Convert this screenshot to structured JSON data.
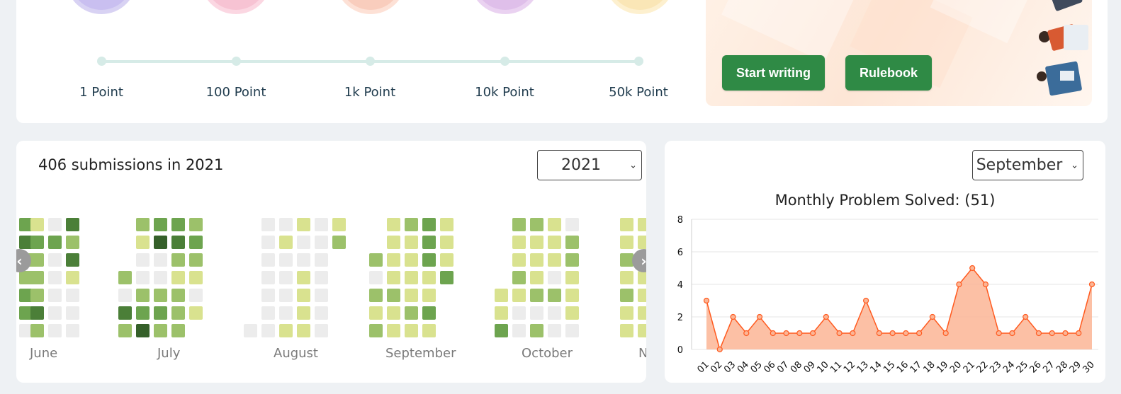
{
  "milestones": [
    {
      "label": "1 Point",
      "badge_color": "#d8d2f3",
      "inner": "#c9bff0",
      "icon": "star-badge-icon"
    },
    {
      "label": "100 Point",
      "badge_color": "#fbd7e2",
      "inner": "#f7c3d3",
      "icon": "burst-badge-icon"
    },
    {
      "label": "1k Point",
      "badge_color": "#fde1d6",
      "inner": "#f9cdbd",
      "icon": "shield-badge-icon"
    },
    {
      "label": "10k Point",
      "badge_color": "#ead2f1",
      "inner": "#dfbfea",
      "icon": "bar-badge-icon"
    },
    {
      "label": "50k Point",
      "badge_color": "#fdf0cf",
      "inner": "#faE6b6",
      "icon": "diamond-badge-icon"
    }
  ],
  "promo": {
    "start_writing": "Start writing",
    "rulebook": "Rulebook",
    "button_color": "#2f8a45"
  },
  "heatmap": {
    "title": "406 submissions in 2021",
    "year_select": "2021",
    "months": [
      "June",
      "July",
      "August",
      "September",
      "October",
      "N"
    ],
    "levels": [
      "#ececec",
      "#d9e28f",
      "#9cc16a",
      "#6da44f",
      "#4b7f38",
      "#35602a"
    ]
  },
  "monthly": {
    "month_select": "September",
    "title": "Monthly Problem Solved: (51)"
  },
  "chart_data": {
    "type": "area",
    "title": "Monthly Problem Solved: (51)",
    "x": [
      "01",
      "02",
      "03",
      "04",
      "05",
      "06",
      "07",
      "08",
      "09",
      "10",
      "11",
      "12",
      "13",
      "14",
      "15",
      "16",
      "17",
      "18",
      "19",
      "20",
      "21",
      "22",
      "23",
      "24",
      "25",
      "26",
      "27",
      "28",
      "29",
      "30"
    ],
    "values": [
      3,
      0,
      2,
      1,
      2,
      1,
      1,
      1,
      1,
      2,
      1,
      1,
      3,
      1,
      1,
      1,
      1,
      2,
      1,
      4,
      5,
      4,
      1,
      1,
      2,
      1,
      1,
      1,
      1,
      4
    ],
    "ylim": [
      0,
      8
    ],
    "yticks": [
      0,
      2,
      4,
      6,
      8
    ],
    "grid": true,
    "line_color": "#ff5a1f",
    "fill_color": "#fbb595"
  }
}
